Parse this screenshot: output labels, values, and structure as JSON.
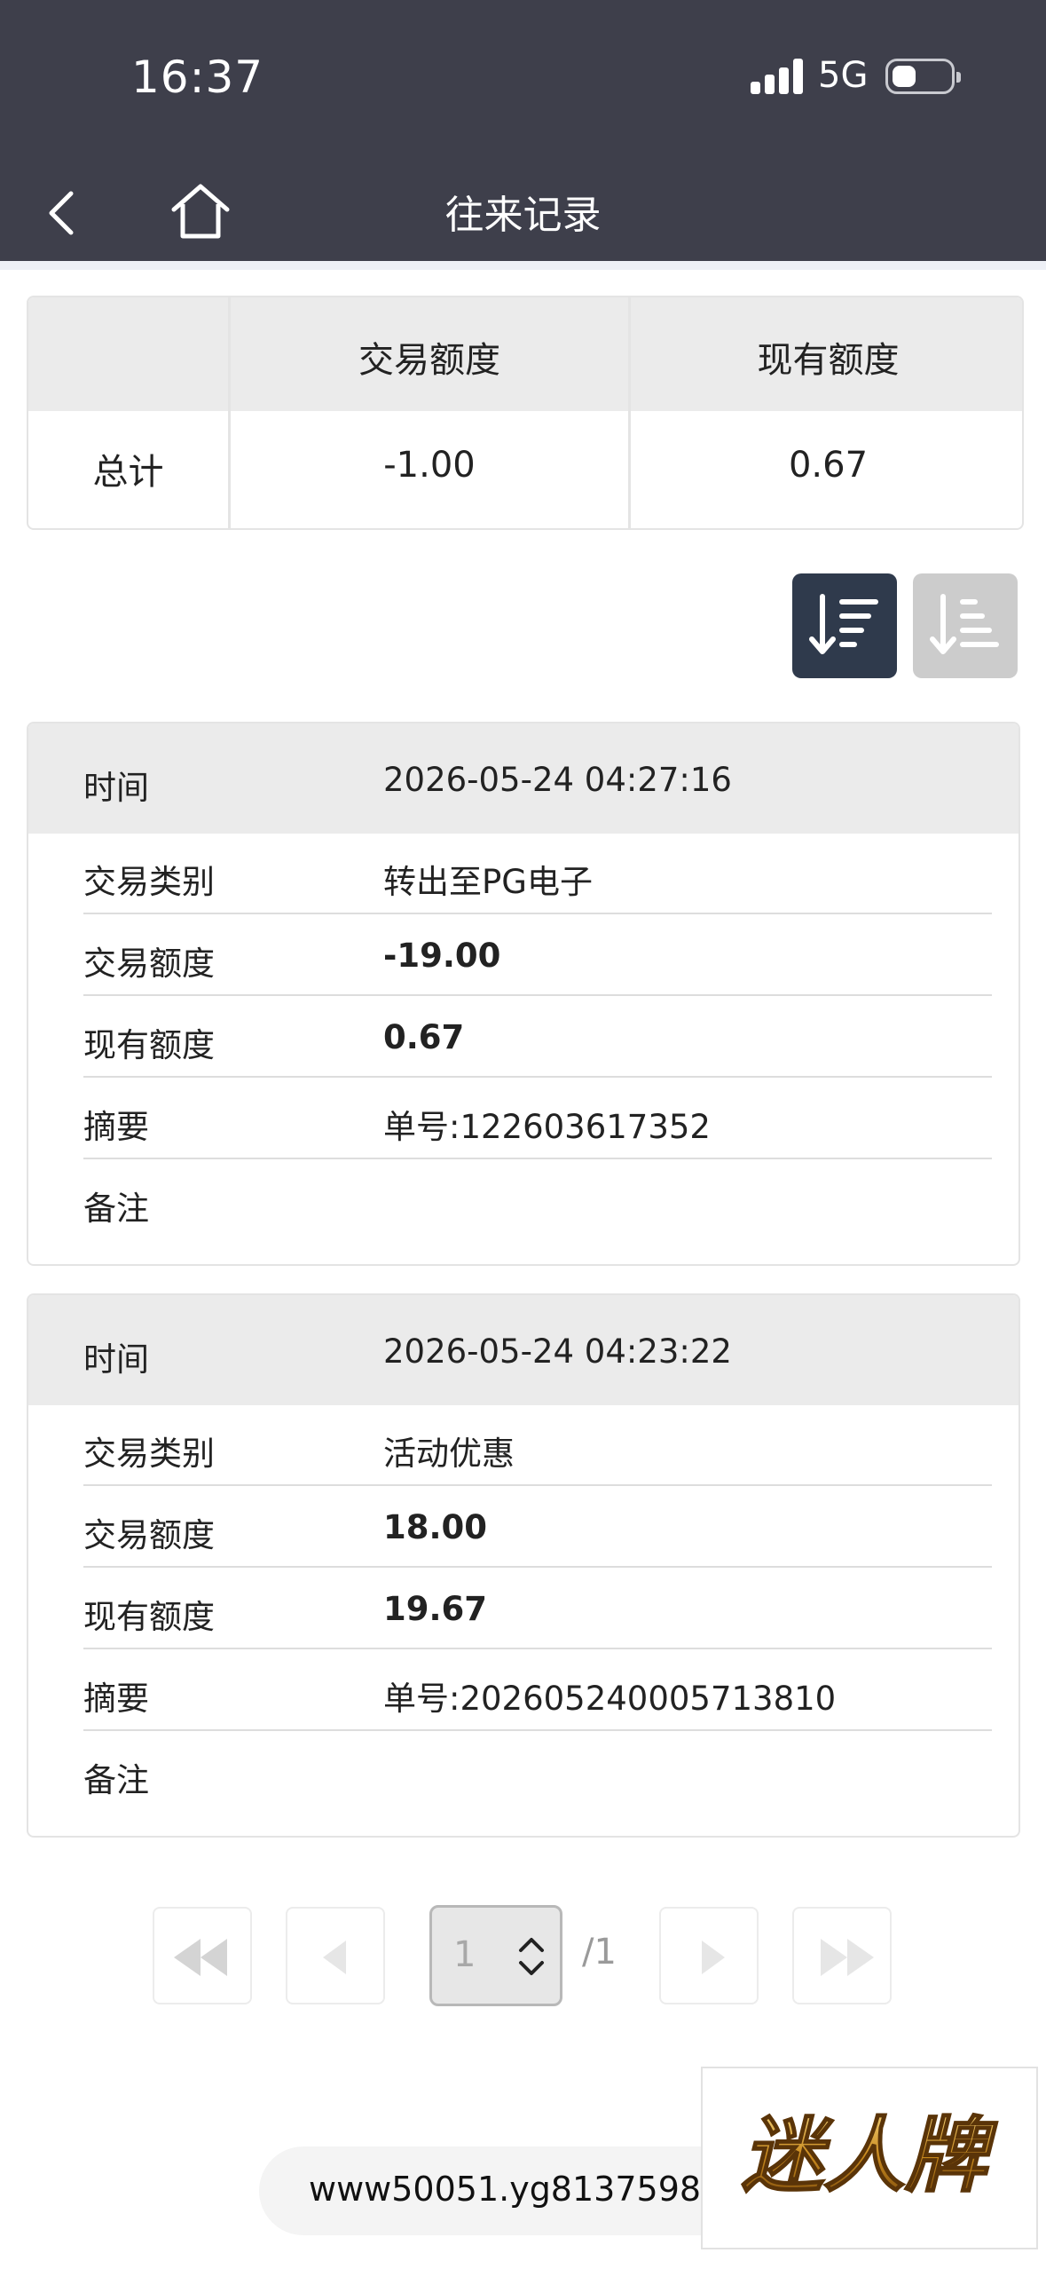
{
  "status_bar": {
    "time": "16:37",
    "network": "5G"
  },
  "header": {
    "title": "往来记录"
  },
  "summary": {
    "head_trade": "交易额度",
    "head_current": "现有额度",
    "row_label": "总计",
    "trade_value": "-1.00",
    "current_value": "0.67"
  },
  "sort": {
    "active": "descending"
  },
  "records": [
    {
      "time_label": "时间",
      "time": "2026-05-24 04:27:16",
      "type_label": "交易类别",
      "type": "转出至PG电子",
      "amount_label": "交易额度",
      "amount": "-19.00",
      "balance_label": "现有额度",
      "balance": "0.67",
      "summary_label": "摘要",
      "summary": "单号:122603617352",
      "note_label": "备注",
      "note": ""
    },
    {
      "time_label": "时间",
      "time": "2026-05-24 04:23:22",
      "type_label": "交易类别",
      "type": "活动优惠",
      "amount_label": "交易额度",
      "amount": "18.00",
      "balance_label": "现有额度",
      "balance": "19.67",
      "summary_label": "摘要",
      "summary": "单号:202605240005713810",
      "note_label": "备注",
      "note": ""
    }
  ],
  "pagination": {
    "current": "1",
    "total": "/1"
  },
  "browser": {
    "url": "www50051.yg8137598.co"
  },
  "logo": {
    "text": "迷人牌"
  },
  "colors": {
    "header_bg": "#3e3f4b",
    "sort_active": "#2f3a4c",
    "sort_inactive": "#cccccc"
  }
}
